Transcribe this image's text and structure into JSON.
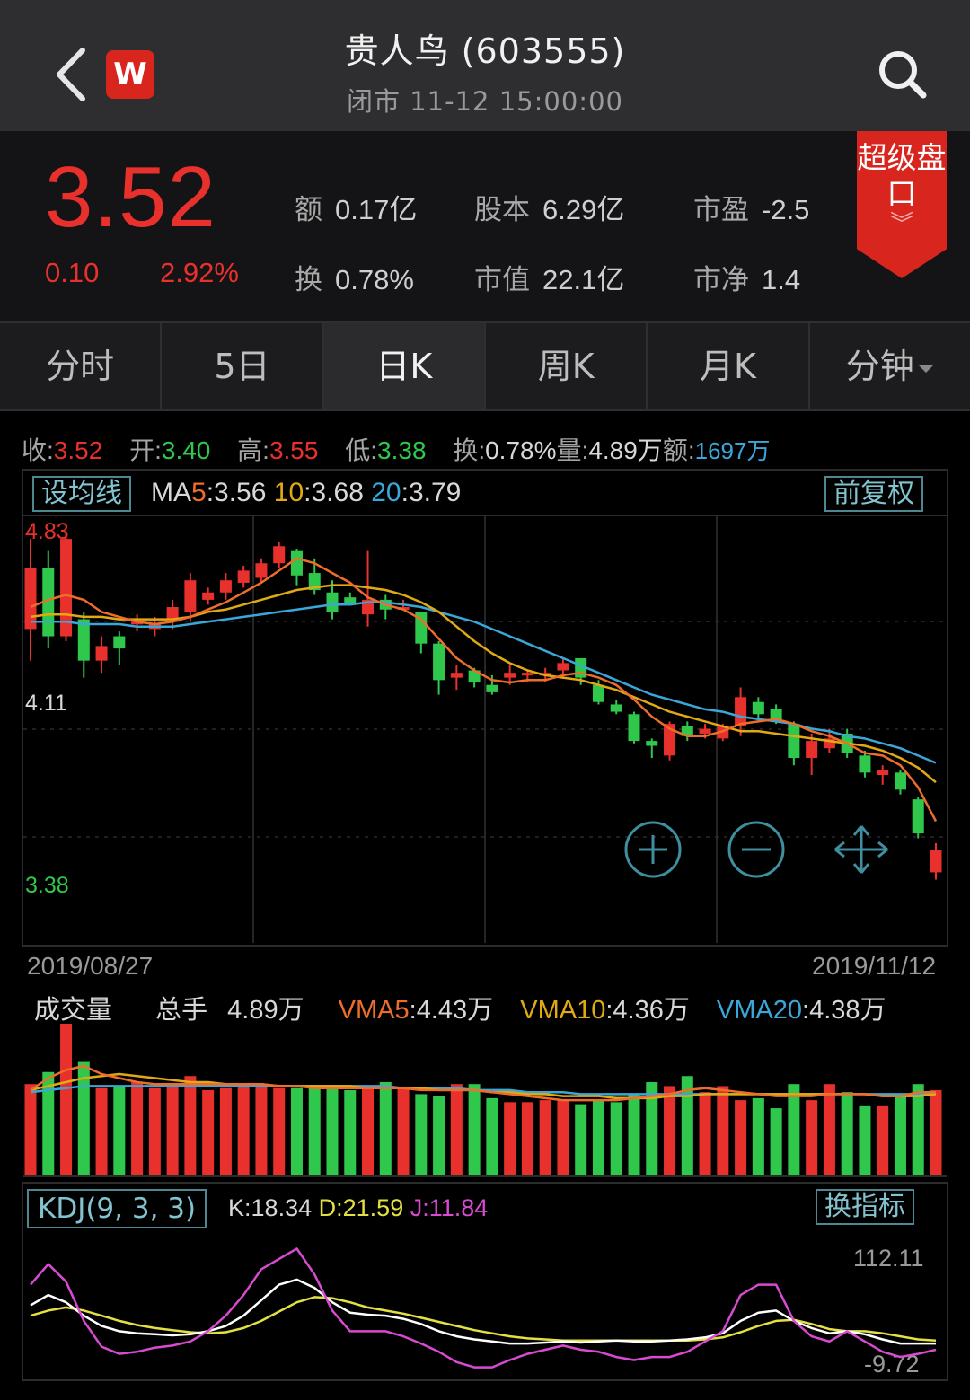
{
  "header": {
    "title": "贵人鸟 (603555)",
    "subtitle": "闭市 11-12 15:00:00",
    "logo_text": "W"
  },
  "quote": {
    "price": "3.52",
    "change": "0.10",
    "change_pct": "2.92%",
    "stats": [
      {
        "label": "额",
        "value": "0.17亿"
      },
      {
        "label": "股本",
        "value": "6.29亿"
      },
      {
        "label": "市盈",
        "value": "-2.5"
      },
      {
        "label": "换",
        "value": "0.78%"
      },
      {
        "label": "市值",
        "value": "22.1亿"
      },
      {
        "label": "市净",
        "value": "1.4"
      }
    ],
    "super_panel": "超级盘口"
  },
  "tabs": [
    "分时",
    "5日",
    "日K",
    "周K",
    "月K",
    "分钟"
  ],
  "active_tab": 2,
  "ohlc": {
    "close_label": "收",
    "close": "3.52",
    "open_label": "开",
    "open": "3.40",
    "high_label": "高",
    "high": "3.55",
    "low_label": "低",
    "low": "3.38",
    "turnover_label": "换",
    "turnover": "0.78%",
    "volume_label": "量",
    "volume": "4.89万",
    "amount_label": "额",
    "amount": "1697万"
  },
  "ma": {
    "set_button": "设均线",
    "ma_prefix": "MA",
    "ma5_key": "5",
    "ma5": "3.56",
    "ma10_key": "10",
    "ma10": "3.68",
    "ma20_key": "20",
    "ma20": "3.79",
    "adjust_button": "前复权"
  },
  "price_axis": {
    "top": "4.83",
    "mid": "4.11",
    "bottom": "3.38"
  },
  "dates": {
    "start": "2019/08/27",
    "end": "2019/11/12"
  },
  "volume": {
    "title": "成交量",
    "total_label": "总手",
    "total": "4.89万",
    "vma5_label": "VMA5",
    "vma5": "4.43万",
    "vma10_label": "VMA10",
    "vma10": "4.36万",
    "vma20_label": "VMA20",
    "vma20": "4.38万"
  },
  "kdj": {
    "title": "KDJ(9, 3, 3)",
    "k_label": "K",
    "k": "18.34",
    "d_label": "D",
    "d": "21.59",
    "j_label": "J",
    "j": "11.84",
    "switch_button": "换指标",
    "axis_top": "112.11",
    "axis_bottom": "-9.72"
  },
  "colors": {
    "up": "#e8312c",
    "down": "#2fc84d",
    "ma5": "#ee6d2a",
    "ma10": "#e1aa14",
    "ma20": "#3aa7d9",
    "k": "#ffffff",
    "d": "#e3e043",
    "j": "#d84bd0"
  },
  "chart_data": {
    "type": "candlestick",
    "price_range": [
      3.38,
      4.83
    ],
    "candles": [
      [
        4.43,
        4.68,
        4.3,
        4.8
      ],
      [
        4.68,
        4.4,
        4.35,
        4.75
      ],
      [
        4.4,
        4.8,
        4.38,
        4.83
      ],
      [
        4.47,
        4.3,
        4.23,
        4.5
      ],
      [
        4.3,
        4.36,
        4.25,
        4.4
      ],
      [
        4.4,
        4.35,
        4.28,
        4.42
      ],
      [
        4.45,
        4.46,
        4.42,
        4.49
      ],
      [
        4.43,
        4.45,
        4.4,
        4.48
      ],
      [
        4.47,
        4.52,
        4.43,
        4.55
      ],
      [
        4.5,
        4.63,
        4.46,
        4.66
      ],
      [
        4.55,
        4.58,
        4.53,
        4.6
      ],
      [
        4.58,
        4.63,
        4.55,
        4.66
      ],
      [
        4.62,
        4.67,
        4.6,
        4.69
      ],
      [
        4.64,
        4.7,
        4.62,
        4.72
      ],
      [
        4.7,
        4.77,
        4.68,
        4.79
      ],
      [
        4.75,
        4.65,
        4.61,
        4.76
      ],
      [
        4.66,
        4.59,
        4.57,
        4.72
      ],
      [
        4.58,
        4.5,
        4.47,
        4.63
      ],
      [
        4.56,
        4.53,
        4.53,
        4.58
      ],
      [
        4.49,
        4.55,
        4.44,
        4.75
      ],
      [
        4.55,
        4.51,
        4.47,
        4.57
      ],
      [
        4.52,
        4.52,
        4.51,
        4.55
      ],
      [
        4.5,
        4.37,
        4.33,
        4.5
      ],
      [
        4.37,
        4.22,
        4.16,
        4.38
      ],
      [
        4.23,
        4.25,
        4.18,
        4.28
      ],
      [
        4.26,
        4.21,
        4.19,
        4.27
      ],
      [
        4.2,
        4.17,
        4.16,
        4.24
      ],
      [
        4.23,
        4.25,
        4.2,
        4.28
      ],
      [
        4.24,
        4.25,
        4.21,
        4.26
      ],
      [
        4.24,
        4.25,
        4.21,
        4.27
      ],
      [
        4.26,
        4.29,
        4.23,
        4.31
      ],
      [
        4.31,
        4.23,
        4.2,
        4.31
      ],
      [
        4.2,
        4.13,
        4.12,
        4.22
      ],
      [
        4.12,
        4.09,
        4.08,
        4.14
      ],
      [
        4.08,
        3.97,
        3.96,
        4.09
      ],
      [
        3.97,
        3.95,
        3.9,
        3.98
      ],
      [
        3.91,
        4.04,
        3.89,
        4.05
      ],
      [
        4.03,
        3.99,
        3.97,
        4.05
      ],
      [
        4.0,
        4.02,
        3.98,
        4.04
      ],
      [
        3.98,
        4.03,
        3.97,
        4.04
      ],
      [
        4.03,
        4.15,
        3.99,
        4.19
      ],
      [
        4.13,
        4.08,
        4.05,
        4.15
      ],
      [
        4.1,
        4.05,
        4.04,
        4.12
      ],
      [
        4.04,
        3.9,
        3.87,
        4.05
      ],
      [
        3.9,
        3.97,
        3.83,
        4.0
      ],
      [
        3.94,
        3.98,
        3.92,
        4.02
      ],
      [
        4.0,
        3.92,
        3.9,
        4.02
      ],
      [
        3.91,
        3.84,
        3.82,
        3.93
      ],
      [
        3.83,
        3.85,
        3.79,
        3.87
      ],
      [
        3.84,
        3.77,
        3.75,
        3.85
      ],
      [
        3.73,
        3.59,
        3.57,
        3.74
      ],
      [
        3.43,
        3.52,
        3.4,
        3.55
      ]
    ],
    "ma5": [
      4.52,
      4.55,
      4.57,
      4.55,
      4.5,
      4.48,
      4.46,
      4.45,
      4.46,
      4.48,
      4.51,
      4.54,
      4.58,
      4.62,
      4.67,
      4.72,
      4.7,
      4.66,
      4.62,
      4.56,
      4.53,
      4.51,
      4.47,
      4.39,
      4.31,
      4.26,
      4.22,
      4.21,
      4.22,
      4.22,
      4.24,
      4.25,
      4.23,
      4.2,
      4.14,
      4.07,
      4.02,
      3.99,
      3.99,
      4.01,
      4.04,
      4.05,
      4.06,
      4.04,
      4.01,
      3.99,
      3.96,
      3.92,
      3.91,
      3.87,
      3.78,
      3.64
    ],
    "ma10": [
      4.48,
      4.49,
      4.49,
      4.48,
      4.48,
      4.47,
      4.47,
      4.47,
      4.47,
      4.48,
      4.5,
      4.51,
      4.53,
      4.55,
      4.57,
      4.59,
      4.6,
      4.61,
      4.61,
      4.6,
      4.59,
      4.57,
      4.54,
      4.5,
      4.44,
      4.38,
      4.33,
      4.29,
      4.26,
      4.24,
      4.23,
      4.22,
      4.2,
      4.18,
      4.15,
      4.12,
      4.09,
      4.07,
      4.05,
      4.03,
      4.01,
      4.01,
      4.0,
      3.99,
      3.98,
      3.97,
      3.96,
      3.95,
      3.93,
      3.9,
      3.86,
      3.8
    ],
    "ma20": [
      4.46,
      4.46,
      4.46,
      4.45,
      4.45,
      4.45,
      4.44,
      4.44,
      4.44,
      4.45,
      4.46,
      4.47,
      4.48,
      4.49,
      4.5,
      4.51,
      4.52,
      4.53,
      4.53,
      4.54,
      4.54,
      4.53,
      4.52,
      4.5,
      4.48,
      4.46,
      4.43,
      4.4,
      4.37,
      4.34,
      4.31,
      4.28,
      4.25,
      4.22,
      4.19,
      4.16,
      4.14,
      4.12,
      4.1,
      4.09,
      4.07,
      4.06,
      4.05,
      4.04,
      4.02,
      4.01,
      3.99,
      3.98,
      3.96,
      3.94,
      3.91,
      3.88
    ],
    "volume_max": 7.5,
    "volume": [
      4.5,
      5.1,
      7.5,
      5.6,
      4.3,
      4.4,
      4.6,
      4.3,
      4.5,
      4.9,
      4.2,
      4.3,
      4.4,
      4.4,
      4.3,
      4.3,
      4.3,
      4.3,
      4.2,
      4.3,
      4.6,
      4.3,
      4.0,
      3.9,
      4.5,
      4.5,
      3.8,
      3.6,
      3.6,
      3.7,
      3.7,
      3.5,
      3.7,
      3.6,
      4.0,
      4.6,
      4.4,
      4.9,
      4.1,
      4.4,
      3.7,
      3.8,
      3.3,
      4.5,
      3.7,
      4.5,
      4.1,
      3.4,
      3.4,
      3.9,
      4.5,
      4.2
    ],
    "vma5": [
      4.2,
      4.8,
      5.2,
      5.4,
      5.0,
      4.8,
      4.6,
      4.5,
      4.5,
      4.5,
      4.5,
      4.5,
      4.5,
      4.5,
      4.4,
      4.4,
      4.3,
      4.3,
      4.3,
      4.3,
      4.3,
      4.3,
      4.2,
      4.2,
      4.2,
      4.2,
      4.1,
      4.0,
      3.9,
      3.8,
      3.7,
      3.7,
      3.7,
      3.7,
      3.8,
      3.9,
      4.0,
      4.2,
      4.3,
      4.2,
      4.1,
      4.0,
      3.9,
      3.9,
      3.9,
      4.0,
      4.0,
      4.0,
      3.9,
      3.9,
      4.1,
      4.1
    ],
    "vma10": [
      4.2,
      4.4,
      4.6,
      4.8,
      4.9,
      5.0,
      4.9,
      4.8,
      4.7,
      4.6,
      4.6,
      4.5,
      4.5,
      4.5,
      4.4,
      4.4,
      4.4,
      4.4,
      4.4,
      4.3,
      4.3,
      4.3,
      4.3,
      4.2,
      4.2,
      4.2,
      4.1,
      4.1,
      4.0,
      4.0,
      3.9,
      3.9,
      3.9,
      3.8,
      3.8,
      3.8,
      3.9,
      3.9,
      4.0,
      4.0,
      4.0,
      4.0,
      4.0,
      4.0,
      4.0,
      4.0,
      4.0,
      4.0,
      3.9,
      3.9,
      3.9,
      4.0
    ],
    "vma20": [
      4.1,
      4.2,
      4.3,
      4.4,
      4.4,
      4.4,
      4.4,
      4.4,
      4.4,
      4.4,
      4.4,
      4.4,
      4.4,
      4.4,
      4.4,
      4.4,
      4.4,
      4.4,
      4.4,
      4.4,
      4.4,
      4.3,
      4.3,
      4.3,
      4.3,
      4.2,
      4.2,
      4.2,
      4.1,
      4.1,
      4.1,
      4.0,
      4.0,
      4.0,
      4.0,
      4.0,
      4.0,
      4.0,
      4.0,
      4.0,
      4.0,
      4.0,
      4.0,
      4.0,
      4.0,
      4.0,
      4.0,
      4.0,
      4.0,
      4.0,
      4.0,
      4.0
    ],
    "kdj_range": [
      -9.72,
      112.11
    ],
    "k": [
      55,
      65,
      58,
      45,
      35,
      30,
      28,
      27,
      26,
      27,
      30,
      35,
      45,
      60,
      75,
      80,
      72,
      58,
      48,
      46,
      45,
      42,
      37,
      30,
      25,
      22,
      20,
      18,
      18,
      19,
      20,
      19,
      20,
      21,
      20,
      20,
      21,
      22,
      24,
      28,
      40,
      48,
      50,
      40,
      33,
      28,
      30,
      27,
      22,
      18,
      18,
      18
    ],
    "d": [
      45,
      50,
      53,
      50,
      45,
      40,
      36,
      33,
      31,
      29,
      28,
      29,
      33,
      40,
      49,
      58,
      63,
      62,
      58,
      53,
      50,
      47,
      43,
      39,
      35,
      31,
      28,
      25,
      23,
      22,
      21,
      21,
      21,
      21,
      21,
      21,
      21,
      21,
      22,
      24,
      29,
      35,
      40,
      41,
      37,
      32,
      30,
      30,
      28,
      25,
      22,
      21
    ],
    "j": [
      75,
      95,
      78,
      40,
      15,
      8,
      10,
      14,
      16,
      20,
      30,
      45,
      65,
      90,
      100,
      110,
      85,
      50,
      30,
      30,
      30,
      25,
      18,
      10,
      0,
      -5,
      -5,
      2,
      8,
      12,
      16,
      12,
      10,
      5,
      2,
      5,
      5,
      10,
      20,
      30,
      65,
      75,
      75,
      40,
      25,
      20,
      30,
      20,
      10,
      5,
      8,
      12
    ]
  }
}
